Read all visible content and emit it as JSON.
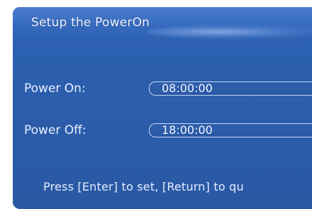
{
  "dialog": {
    "title": "Setup the PowerOn"
  },
  "settings": {
    "power_on": {
      "label": "Power On:",
      "value": "08:00:00"
    },
    "power_off": {
      "label": "Power Off:",
      "value": "18:00:00"
    }
  },
  "footer": {
    "hint": "Press [Enter] to set, [Return] to qu"
  },
  "colors": {
    "background": "#2b5eac",
    "header": "#3469bd",
    "text": "#e9efff",
    "field_border": "#c7d6f2"
  }
}
